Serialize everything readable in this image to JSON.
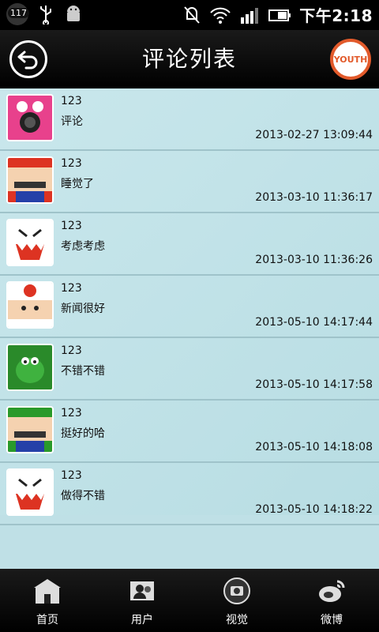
{
  "status_bar": {
    "notification_count": "117",
    "time": "下午2:18",
    "icons": [
      "notification-icon",
      "usb-icon",
      "android-icon",
      "silent-icon",
      "wifi-icon",
      "signal-icon",
      "battery-icon"
    ]
  },
  "header": {
    "title": "评论列表",
    "logo_text": "YOUTH",
    "back_icon": "back-arrow-icon"
  },
  "comments": [
    {
      "user": "123",
      "text": "评论",
      "time": "2013-02-27 13:09:44",
      "avatar": "pink-mushroom"
    },
    {
      "user": "123",
      "text": "睡觉了",
      "time": "2013-03-10 11:36:17",
      "avatar": "mario"
    },
    {
      "user": "123",
      "text": "考虑考虑",
      "time": "2013-03-10 11:36:26",
      "avatar": "boo"
    },
    {
      "user": "123",
      "text": "新闻很好",
      "time": "2013-05-10 14:17:44",
      "avatar": "toad"
    },
    {
      "user": "123",
      "text": "不错不错",
      "time": "2013-05-10 14:17:58",
      "avatar": "yoshi"
    },
    {
      "user": "123",
      "text": "挺好的哈",
      "time": "2013-05-10 14:18:08",
      "avatar": "luigi"
    },
    {
      "user": "123",
      "text": "做得不错",
      "time": "2013-05-10 14:18:22",
      "avatar": "boo"
    }
  ],
  "bottom_nav": {
    "tabs": [
      {
        "label": "首页",
        "icon": "home-icon"
      },
      {
        "label": "用户",
        "icon": "users-icon"
      },
      {
        "label": "视觉",
        "icon": "camera-icon"
      },
      {
        "label": "微博",
        "icon": "weibo-icon"
      }
    ]
  },
  "colors": {
    "accent": "#e25a2b",
    "list_bg": "#bfe0e6"
  }
}
